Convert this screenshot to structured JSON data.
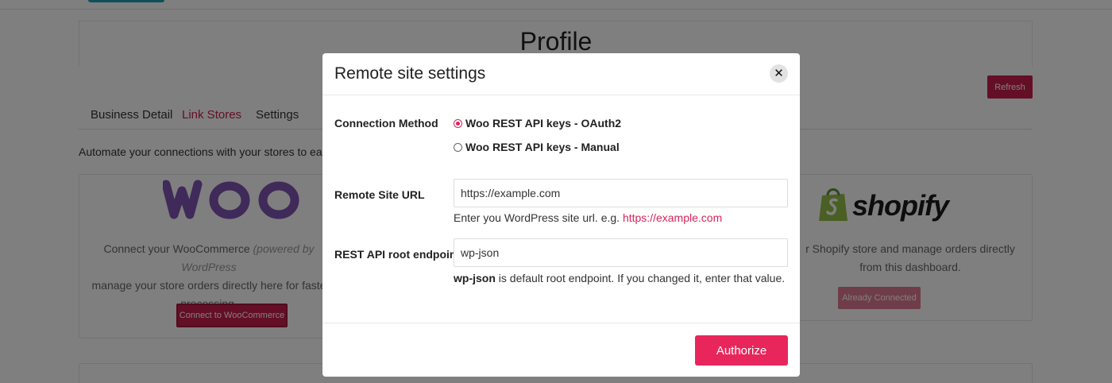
{
  "page": {
    "title": "Profile",
    "refresh_label": "Refresh",
    "tabs": [
      {
        "label": "Business Detail"
      },
      {
        "label": "Link Stores"
      },
      {
        "label": "Settings"
      }
    ],
    "intro": "Automate your connections with your stores to easily p",
    "woo": {
      "logo_text": "WOO",
      "text_main": "Connect your WooCommerce",
      "text_italic": "(powered by WordPress",
      "text_rest": "manage your store orders directly here for faste processing.",
      "button_label": "Connect to WooCommerce"
    },
    "shopify": {
      "logo_text": "shopify",
      "text": "r Shopify store and manage orders directly from this dashboard.",
      "button_label": "Already Connected"
    }
  },
  "modal": {
    "title": "Remote site settings",
    "close_symbol": "✕",
    "connection_method_label": "Connection Method",
    "options": [
      {
        "label": "Woo REST API keys - OAuth2",
        "checked": true
      },
      {
        "label": "Woo REST API keys - Manual",
        "checked": false
      }
    ],
    "remote_url_label": "Remote Site URL",
    "remote_url_value": "https://example.com",
    "remote_url_help_prefix": "Enter you WordPress site url. e.g.",
    "remote_url_help_link": "https://example.com",
    "rest_root_label": "REST API root endpoint",
    "rest_root_value": "wp-json",
    "rest_root_help_bold": "wp-json",
    "rest_root_help_rest": "is default root endpoint. If you changed it, enter that value.",
    "authorize_label": "Authorize"
  },
  "colors": {
    "brand": "#c91f4c",
    "authorize": "#e8265c",
    "woo_purple": "#7f54b3",
    "shopify_green": "#95bf47"
  }
}
